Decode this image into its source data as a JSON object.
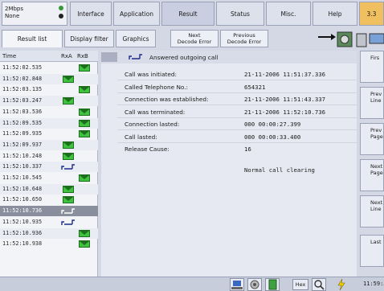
{
  "status": {
    "line1": "2Mbps",
    "line2": "None"
  },
  "menu": {
    "tabs": [
      "Interface",
      "Application",
      "Result",
      "Status",
      "Misc.",
      "Help"
    ],
    "version": "3.3"
  },
  "subtabs": {
    "result_list": "Result list",
    "display_filter": "Display filter",
    "graphics": "Graphics",
    "next_decode_error": [
      "Next",
      "Decode Error"
    ],
    "previous_decode_error": [
      "Previous",
      "Decode Error"
    ]
  },
  "list": {
    "headers": {
      "time": "Time",
      "rxa": "RxA",
      "rxb": "RxB"
    },
    "rows": [
      {
        "time": "11:52:02.535",
        "col": "B",
        "icon": "envelope"
      },
      {
        "time": "11:52:02.848",
        "col": "A",
        "icon": "envelope"
      },
      {
        "time": "11:52:03.135",
        "col": "B",
        "icon": "envelope"
      },
      {
        "time": "11:52:03.247",
        "col": "A",
        "icon": "envelope"
      },
      {
        "time": "11:52:03.536",
        "col": "B",
        "icon": "envelope"
      },
      {
        "time": "11:52:09.535",
        "col": "B",
        "icon": "envelope"
      },
      {
        "time": "11:52:09.935",
        "col": "B",
        "icon": "envelope"
      },
      {
        "time": "11:52:09.937",
        "col": "A",
        "icon": "envelope"
      },
      {
        "time": "11:52:10.248",
        "col": "A",
        "icon": "envelope"
      },
      {
        "time": "11:52:10.337",
        "col": "A",
        "icon": "phone"
      },
      {
        "time": "11:52:10.545",
        "col": "B",
        "icon": "envelope"
      },
      {
        "time": "11:52:10.648",
        "col": "A",
        "icon": "envelope"
      },
      {
        "time": "11:52:10.650",
        "col": "A",
        "icon": "envelope"
      },
      {
        "time": "11:52:10.736",
        "col": "A",
        "icon": "phone",
        "selected": true
      },
      {
        "time": "11:52:10.935",
        "col": "A",
        "icon": "phone"
      },
      {
        "time": "11:52:10.936",
        "col": "B",
        "icon": "envelope"
      },
      {
        "time": "11:52:10.938",
        "col": "B",
        "icon": "envelope"
      }
    ]
  },
  "detail": {
    "title": "Answered outgoing call",
    "rows": [
      {
        "label": "Call was initiated:",
        "value": "21-11-2006 11:51:37.336"
      },
      {
        "label": "Called Telephone No.:",
        "value": "654321"
      },
      {
        "label": "Connection was established:",
        "value": "21-11-2006 11:51:43.337"
      },
      {
        "label": "Call was terminated:",
        "value": "21-11-2006 11:52:10.736"
      },
      {
        "label": "Connection lasted:",
        "value": "000 00:00:27.399"
      },
      {
        "label": "Call lasted:",
        "value": "000 00:00:33.400"
      },
      {
        "label": "Release Cause:",
        "value": "16"
      }
    ],
    "release_cause_text": "Normal call clearing"
  },
  "side_buttons": [
    "Firs",
    "Prev Line",
    "Prev Page",
    "Next Page",
    "Next Line",
    "Last"
  ],
  "bottom": {
    "hex_label": "Hex",
    "clock": "11:59:5"
  },
  "colors": {
    "background": "#d4d8e4",
    "envelope": "#3fc23f",
    "selected_row": "#8a8f9e"
  }
}
